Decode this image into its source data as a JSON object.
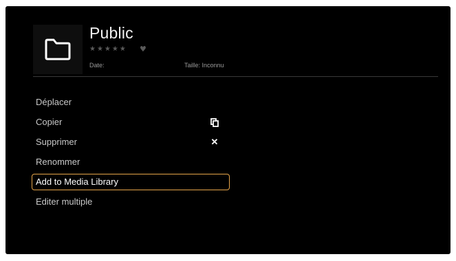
{
  "header": {
    "title": "Public",
    "rating_stars": "★★★★★",
    "heart": "♥",
    "date_label": "Date:",
    "size_label": "Taille: Inconnu",
    "icon": "folder-icon"
  },
  "menu": {
    "items": [
      {
        "label": "Déplacer"
      },
      {
        "label": "Copier",
        "icon": "copy-icon"
      },
      {
        "label": "Supprimer",
        "icon": "close-icon"
      },
      {
        "label": "Renommer"
      },
      {
        "label": "Add to Media Library",
        "selected": true
      },
      {
        "label": "Editer multiple"
      }
    ]
  },
  "colors": {
    "background": "#000000",
    "highlight": "#e8a64a"
  }
}
